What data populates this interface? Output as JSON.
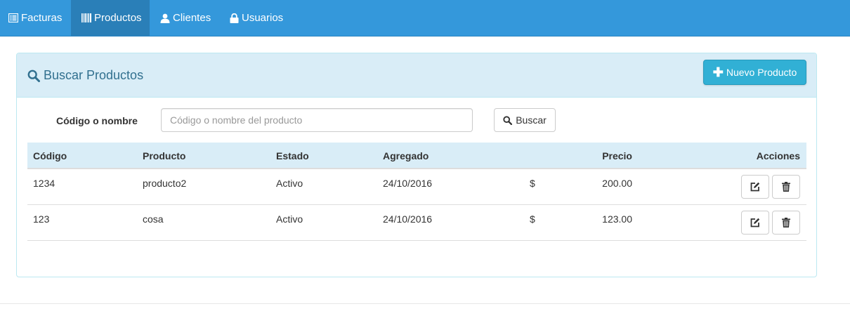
{
  "nav": {
    "items": [
      {
        "label": "Facturas",
        "icon": "list-alt-icon"
      },
      {
        "label": "Productos",
        "icon": "barcode-icon",
        "active": true
      },
      {
        "label": "Clientes",
        "icon": "user-icon"
      },
      {
        "label": "Usuarios",
        "icon": "lock-icon"
      }
    ]
  },
  "panel": {
    "title": "Buscar Productos",
    "new_button_label": "Nuevo Producto"
  },
  "search": {
    "label": "Código o nombre",
    "placeholder": "Código o nombre del producto",
    "value": "",
    "button_label": "Buscar"
  },
  "table": {
    "headers": {
      "codigo": "Código",
      "producto": "Producto",
      "estado": "Estado",
      "agregado": "Agregado",
      "precio": "Precio",
      "acciones": "Acciones"
    },
    "rows": [
      {
        "codigo": "1234",
        "producto": "producto2",
        "estado": "Activo",
        "agregado": "24/10/2016",
        "currency": "$",
        "precio": "200.00"
      },
      {
        "codigo": "123",
        "producto": "cosa",
        "estado": "Activo",
        "agregado": "24/10/2016",
        "currency": "$",
        "precio": "123.00"
      }
    ]
  },
  "colors": {
    "navbar": "#3498db",
    "navbar_active": "#2a7fb8",
    "panel_heading": "#d9edf7",
    "panel_title": "#31708f",
    "info_button": "#31b0d5"
  }
}
